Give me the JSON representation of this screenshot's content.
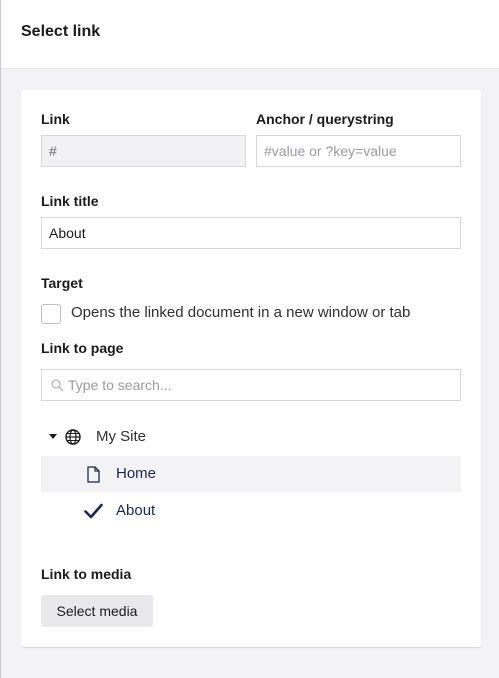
{
  "dialog": {
    "title": "Select link"
  },
  "link": {
    "label": "Link",
    "value": "#"
  },
  "anchor": {
    "label": "Anchor / querystring",
    "placeholder": "#value or ?key=value"
  },
  "link_title": {
    "label": "Link title",
    "value": "About"
  },
  "target": {
    "label": "Target",
    "checkbox_label": "Opens the linked document in a new window or tab",
    "checked": false
  },
  "link_to_page": {
    "label": "Link to page",
    "search_placeholder": "Type to search...",
    "tree": {
      "root": {
        "label": "My Site",
        "icon": "globe-icon",
        "expanded": true
      },
      "children": [
        {
          "label": "Home",
          "icon": "document-icon"
        },
        {
          "label": "About",
          "icon": "checkmark-icon",
          "selected": true
        }
      ]
    }
  },
  "link_to_media": {
    "label": "Link to media",
    "button_label": "Select media"
  },
  "colors": {
    "accent": "#1b264f",
    "background": "#f3f3f5",
    "card": "#ffffff"
  }
}
